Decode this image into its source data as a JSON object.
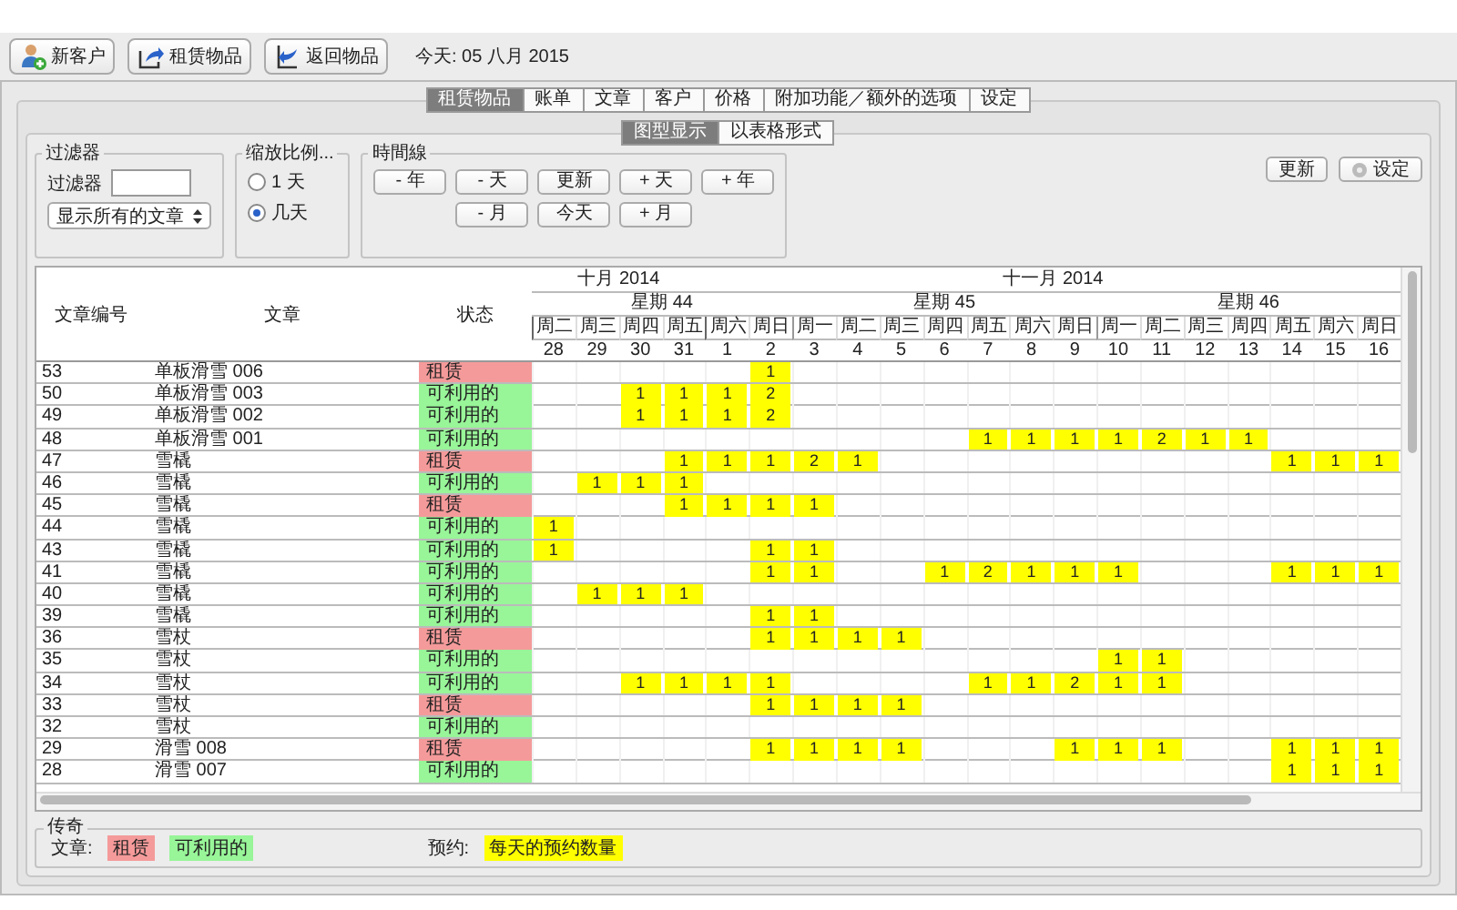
{
  "toolbar": {
    "buttons": [
      {
        "label": "新客户",
        "kind": "person"
      },
      {
        "label": "租赁物品",
        "kind": "out"
      },
      {
        "label": "返回物品",
        "kind": "back"
      }
    ],
    "today": "今天: 05 八月 2015"
  },
  "tabs": [
    {
      "label": "租赁物品",
      "selected": true
    },
    {
      "label": "账单",
      "selected": false
    },
    {
      "label": "文章",
      "selected": false
    },
    {
      "label": "客户",
      "selected": false
    },
    {
      "label": "价格",
      "selected": false
    },
    {
      "label": "附加功能／额外的选项",
      "selected": false
    },
    {
      "label": "设定",
      "selected": false
    }
  ],
  "view_tabs": [
    {
      "label": "图型显示",
      "selected": true
    },
    {
      "label": "以表格形式",
      "selected": false
    }
  ],
  "filter": {
    "title": "过滤器",
    "label": "过滤器",
    "select": "显示所有的文章"
  },
  "scale": {
    "title": "缩放比例...",
    "options": [
      {
        "label": "1 天",
        "selected": false
      },
      {
        "label": "几天",
        "selected": true
      }
    ]
  },
  "timeline": {
    "title": "時間線",
    "rows": [
      [
        "- 年",
        "- 天",
        "更新",
        "+ 天",
        "+ 年"
      ],
      [
        "",
        "- 月",
        "今天",
        "+ 月"
      ]
    ]
  },
  "actions": {
    "refresh": "更新",
    "settings": "设定"
  },
  "table": {
    "columns": [
      "文章编号",
      "文章",
      "状态"
    ],
    "months": [
      "十月 2014",
      "十一月 2014"
    ],
    "weeks": [
      "星期 44",
      "星期 45",
      "星期 46"
    ],
    "days": [
      {
        "weekday": "周二",
        "date": "28",
        "month_start": true,
        "week_start": true
      },
      {
        "weekday": "周三",
        "date": "29",
        "month_start": false,
        "week_start": false
      },
      {
        "weekday": "周四",
        "date": "30",
        "month_start": false,
        "week_start": false
      },
      {
        "weekday": "周五",
        "date": "31",
        "month_start": false,
        "week_start": false
      },
      {
        "weekday": "周六",
        "date": "1",
        "month_start": true,
        "week_start": false
      },
      {
        "weekday": "周日",
        "date": "2",
        "month_start": false,
        "week_start": false
      },
      {
        "weekday": "周一",
        "date": "3",
        "month_start": false,
        "week_start": true
      },
      {
        "weekday": "周二",
        "date": "4",
        "month_start": false,
        "week_start": false
      },
      {
        "weekday": "周三",
        "date": "5",
        "month_start": false,
        "week_start": false
      },
      {
        "weekday": "周四",
        "date": "6",
        "month_start": false,
        "week_start": false
      },
      {
        "weekday": "周五",
        "date": "7",
        "month_start": false,
        "week_start": false
      },
      {
        "weekday": "周六",
        "date": "8",
        "month_start": false,
        "week_start": false
      },
      {
        "weekday": "周日",
        "date": "9",
        "month_start": false,
        "week_start": false
      },
      {
        "weekday": "周一",
        "date": "10",
        "month_start": false,
        "week_start": true
      },
      {
        "weekday": "周二",
        "date": "11",
        "month_start": false,
        "week_start": false
      },
      {
        "weekday": "周三",
        "date": "12",
        "month_start": false,
        "week_start": false
      },
      {
        "weekday": "周四",
        "date": "13",
        "month_start": false,
        "week_start": false
      },
      {
        "weekday": "周五",
        "date": "14",
        "month_start": false,
        "week_start": false
      },
      {
        "weekday": "周六",
        "date": "15",
        "month_start": false,
        "week_start": false
      },
      {
        "weekday": "周日",
        "date": "16",
        "month_start": false,
        "week_start": false
      }
    ],
    "rows": [
      {
        "id": "53",
        "article": "单板滑雪 006",
        "status": {
          "label": "租赁",
          "kind": "rented"
        },
        "bookings": [
          {
            "booked": false
          },
          {
            "booked": false
          },
          {
            "booked": false
          },
          {
            "booked": false
          },
          {
            "booked": false
          },
          {
            "booked": true,
            "count": "1"
          },
          {
            "booked": false
          },
          {
            "booked": false
          },
          {
            "booked": false
          },
          {
            "booked": false
          },
          {
            "booked": false
          },
          {
            "booked": false
          },
          {
            "booked": false
          },
          {
            "booked": false
          },
          {
            "booked": false
          },
          {
            "booked": false
          },
          {
            "booked": false
          },
          {
            "booked": false
          },
          {
            "booked": false
          },
          {
            "booked": false
          }
        ]
      },
      {
        "id": "50",
        "article": "单板滑雪 003",
        "status": {
          "label": "可利用的",
          "kind": "available"
        },
        "bookings": [
          {
            "booked": false
          },
          {
            "booked": false
          },
          {
            "booked": true,
            "count": "1"
          },
          {
            "booked": true,
            "count": "1"
          },
          {
            "booked": true,
            "count": "1"
          },
          {
            "booked": true,
            "count": "2"
          },
          {
            "booked": false
          },
          {
            "booked": false
          },
          {
            "booked": false
          },
          {
            "booked": false
          },
          {
            "booked": false
          },
          {
            "booked": false
          },
          {
            "booked": false
          },
          {
            "booked": false
          },
          {
            "booked": false
          },
          {
            "booked": false
          },
          {
            "booked": false
          },
          {
            "booked": false
          },
          {
            "booked": false
          },
          {
            "booked": false
          }
        ]
      },
      {
        "id": "49",
        "article": "单板滑雪 002",
        "status": {
          "label": "可利用的",
          "kind": "available"
        },
        "bookings": [
          {
            "booked": false
          },
          {
            "booked": false
          },
          {
            "booked": true,
            "count": "1"
          },
          {
            "booked": true,
            "count": "1"
          },
          {
            "booked": true,
            "count": "1"
          },
          {
            "booked": true,
            "count": "2"
          },
          {
            "booked": false
          },
          {
            "booked": false
          },
          {
            "booked": false
          },
          {
            "booked": false
          },
          {
            "booked": false
          },
          {
            "booked": false
          },
          {
            "booked": false
          },
          {
            "booked": false
          },
          {
            "booked": false
          },
          {
            "booked": false
          },
          {
            "booked": false
          },
          {
            "booked": false
          },
          {
            "booked": false
          },
          {
            "booked": false
          }
        ]
      },
      {
        "id": "48",
        "article": "单板滑雪 001",
        "status": {
          "label": "可利用的",
          "kind": "available"
        },
        "bookings": [
          {
            "booked": false
          },
          {
            "booked": false
          },
          {
            "booked": false
          },
          {
            "booked": false
          },
          {
            "booked": false
          },
          {
            "booked": false
          },
          {
            "booked": false
          },
          {
            "booked": false
          },
          {
            "booked": false
          },
          {
            "booked": false
          },
          {
            "booked": true,
            "count": "1"
          },
          {
            "booked": true,
            "count": "1"
          },
          {
            "booked": true,
            "count": "1"
          },
          {
            "booked": true,
            "count": "1"
          },
          {
            "booked": true,
            "count": "2"
          },
          {
            "booked": true,
            "count": "1"
          },
          {
            "booked": true,
            "count": "1"
          },
          {
            "booked": false
          },
          {
            "booked": false
          },
          {
            "booked": false
          }
        ]
      },
      {
        "id": "47",
        "article": "雪橇",
        "status": {
          "label": "租赁",
          "kind": "rented"
        },
        "bookings": [
          {
            "booked": false
          },
          {
            "booked": false
          },
          {
            "booked": false
          },
          {
            "booked": true,
            "count": "1"
          },
          {
            "booked": true,
            "count": "1"
          },
          {
            "booked": true,
            "count": "1"
          },
          {
            "booked": true,
            "count": "2"
          },
          {
            "booked": true,
            "count": "1"
          },
          {
            "booked": false
          },
          {
            "booked": false
          },
          {
            "booked": false
          },
          {
            "booked": false
          },
          {
            "booked": false
          },
          {
            "booked": false
          },
          {
            "booked": false
          },
          {
            "booked": false
          },
          {
            "booked": false
          },
          {
            "booked": true,
            "count": "1"
          },
          {
            "booked": true,
            "count": "1"
          },
          {
            "booked": true,
            "count": "1"
          }
        ]
      },
      {
        "id": "46",
        "article": "雪橇",
        "status": {
          "label": "可利用的",
          "kind": "available"
        },
        "bookings": [
          {
            "booked": false
          },
          {
            "booked": true,
            "count": "1"
          },
          {
            "booked": true,
            "count": "1"
          },
          {
            "booked": true,
            "count": "1"
          },
          {
            "booked": false
          },
          {
            "booked": false
          },
          {
            "booked": false
          },
          {
            "booked": false
          },
          {
            "booked": false
          },
          {
            "booked": false
          },
          {
            "booked": false
          },
          {
            "booked": false
          },
          {
            "booked": false
          },
          {
            "booked": false
          },
          {
            "booked": false
          },
          {
            "booked": false
          },
          {
            "booked": false
          },
          {
            "booked": false
          },
          {
            "booked": false
          },
          {
            "booked": false
          }
        ]
      },
      {
        "id": "45",
        "article": "雪橇",
        "status": {
          "label": "租赁",
          "kind": "rented"
        },
        "bookings": [
          {
            "booked": false
          },
          {
            "booked": false
          },
          {
            "booked": false
          },
          {
            "booked": true,
            "count": "1"
          },
          {
            "booked": true,
            "count": "1"
          },
          {
            "booked": true,
            "count": "1"
          },
          {
            "booked": true,
            "count": "1"
          },
          {
            "booked": false
          },
          {
            "booked": false
          },
          {
            "booked": false
          },
          {
            "booked": false
          },
          {
            "booked": false
          },
          {
            "booked": false
          },
          {
            "booked": false
          },
          {
            "booked": false
          },
          {
            "booked": false
          },
          {
            "booked": false
          },
          {
            "booked": false
          },
          {
            "booked": false
          },
          {
            "booked": false
          }
        ]
      },
      {
        "id": "44",
        "article": "雪橇",
        "status": {
          "label": "可利用的",
          "kind": "available"
        },
        "bookings": [
          {
            "booked": true,
            "count": "1"
          },
          {
            "booked": false
          },
          {
            "booked": false
          },
          {
            "booked": false
          },
          {
            "booked": false
          },
          {
            "booked": false
          },
          {
            "booked": false
          },
          {
            "booked": false
          },
          {
            "booked": false
          },
          {
            "booked": false
          },
          {
            "booked": false
          },
          {
            "booked": false
          },
          {
            "booked": false
          },
          {
            "booked": false
          },
          {
            "booked": false
          },
          {
            "booked": false
          },
          {
            "booked": false
          },
          {
            "booked": false
          },
          {
            "booked": false
          },
          {
            "booked": false
          }
        ]
      },
      {
        "id": "43",
        "article": "雪橇",
        "status": {
          "label": "可利用的",
          "kind": "available"
        },
        "bookings": [
          {
            "booked": true,
            "count": "1"
          },
          {
            "booked": false
          },
          {
            "booked": false
          },
          {
            "booked": false
          },
          {
            "booked": false
          },
          {
            "booked": true,
            "count": "1"
          },
          {
            "booked": true,
            "count": "1"
          },
          {
            "booked": false
          },
          {
            "booked": false
          },
          {
            "booked": false
          },
          {
            "booked": false
          },
          {
            "booked": false
          },
          {
            "booked": false
          },
          {
            "booked": false
          },
          {
            "booked": false
          },
          {
            "booked": false
          },
          {
            "booked": false
          },
          {
            "booked": false
          },
          {
            "booked": false
          },
          {
            "booked": false
          }
        ]
      },
      {
        "id": "41",
        "article": "雪橇",
        "status": {
          "label": "可利用的",
          "kind": "available"
        },
        "bookings": [
          {
            "booked": false
          },
          {
            "booked": false
          },
          {
            "booked": false
          },
          {
            "booked": false
          },
          {
            "booked": false
          },
          {
            "booked": true,
            "count": "1"
          },
          {
            "booked": true,
            "count": "1"
          },
          {
            "booked": false
          },
          {
            "booked": false
          },
          {
            "booked": true,
            "count": "1"
          },
          {
            "booked": true,
            "count": "2"
          },
          {
            "booked": true,
            "count": "1"
          },
          {
            "booked": true,
            "count": "1"
          },
          {
            "booked": true,
            "count": "1"
          },
          {
            "booked": false
          },
          {
            "booked": false
          },
          {
            "booked": false
          },
          {
            "booked": true,
            "count": "1"
          },
          {
            "booked": true,
            "count": "1"
          },
          {
            "booked": true,
            "count": "1"
          }
        ]
      },
      {
        "id": "40",
        "article": "雪橇",
        "status": {
          "label": "可利用的",
          "kind": "available"
        },
        "bookings": [
          {
            "booked": false
          },
          {
            "booked": true,
            "count": "1"
          },
          {
            "booked": true,
            "count": "1"
          },
          {
            "booked": true,
            "count": "1"
          },
          {
            "booked": false
          },
          {
            "booked": false
          },
          {
            "booked": false
          },
          {
            "booked": false
          },
          {
            "booked": false
          },
          {
            "booked": false
          },
          {
            "booked": false
          },
          {
            "booked": false
          },
          {
            "booked": false
          },
          {
            "booked": false
          },
          {
            "booked": false
          },
          {
            "booked": false
          },
          {
            "booked": false
          },
          {
            "booked": false
          },
          {
            "booked": false
          },
          {
            "booked": false
          }
        ]
      },
      {
        "id": "39",
        "article": "雪橇",
        "status": {
          "label": "可利用的",
          "kind": "available"
        },
        "bookings": [
          {
            "booked": false
          },
          {
            "booked": false
          },
          {
            "booked": false
          },
          {
            "booked": false
          },
          {
            "booked": false
          },
          {
            "booked": true,
            "count": "1"
          },
          {
            "booked": true,
            "count": "1"
          },
          {
            "booked": false
          },
          {
            "booked": false
          },
          {
            "booked": false
          },
          {
            "booked": false
          },
          {
            "booked": false
          },
          {
            "booked": false
          },
          {
            "booked": false
          },
          {
            "booked": false
          },
          {
            "booked": false
          },
          {
            "booked": false
          },
          {
            "booked": false
          },
          {
            "booked": false
          },
          {
            "booked": false
          }
        ]
      },
      {
        "id": "36",
        "article": "雪杖",
        "status": {
          "label": "租赁",
          "kind": "rented"
        },
        "bookings": [
          {
            "booked": false
          },
          {
            "booked": false
          },
          {
            "booked": false
          },
          {
            "booked": false
          },
          {
            "booked": false
          },
          {
            "booked": true,
            "count": "1"
          },
          {
            "booked": true,
            "count": "1"
          },
          {
            "booked": true,
            "count": "1"
          },
          {
            "booked": true,
            "count": "1"
          },
          {
            "booked": false
          },
          {
            "booked": false
          },
          {
            "booked": false
          },
          {
            "booked": false
          },
          {
            "booked": false
          },
          {
            "booked": false
          },
          {
            "booked": false
          },
          {
            "booked": false
          },
          {
            "booked": false
          },
          {
            "booked": false
          },
          {
            "booked": false
          }
        ]
      },
      {
        "id": "35",
        "article": "雪杖",
        "status": {
          "label": "可利用的",
          "kind": "available"
        },
        "bookings": [
          {
            "booked": false
          },
          {
            "booked": false
          },
          {
            "booked": false
          },
          {
            "booked": false
          },
          {
            "booked": false
          },
          {
            "booked": false
          },
          {
            "booked": false
          },
          {
            "booked": false
          },
          {
            "booked": false
          },
          {
            "booked": false
          },
          {
            "booked": false
          },
          {
            "booked": false
          },
          {
            "booked": false
          },
          {
            "booked": true,
            "count": "1"
          },
          {
            "booked": true,
            "count": "1"
          },
          {
            "booked": false
          },
          {
            "booked": false
          },
          {
            "booked": false
          },
          {
            "booked": false
          },
          {
            "booked": false
          }
        ]
      },
      {
        "id": "34",
        "article": "雪杖",
        "status": {
          "label": "可利用的",
          "kind": "available"
        },
        "bookings": [
          {
            "booked": false
          },
          {
            "booked": false
          },
          {
            "booked": true,
            "count": "1"
          },
          {
            "booked": true,
            "count": "1"
          },
          {
            "booked": true,
            "count": "1"
          },
          {
            "booked": true,
            "count": "1"
          },
          {
            "booked": false
          },
          {
            "booked": false
          },
          {
            "booked": false
          },
          {
            "booked": false
          },
          {
            "booked": true,
            "count": "1"
          },
          {
            "booked": true,
            "count": "1"
          },
          {
            "booked": true,
            "count": "2"
          },
          {
            "booked": true,
            "count": "1"
          },
          {
            "booked": true,
            "count": "1"
          },
          {
            "booked": false
          },
          {
            "booked": false
          },
          {
            "booked": false
          },
          {
            "booked": false
          },
          {
            "booked": false
          }
        ]
      },
      {
        "id": "33",
        "article": "雪杖",
        "status": {
          "label": "租赁",
          "kind": "rented"
        },
        "bookings": [
          {
            "booked": false
          },
          {
            "booked": false
          },
          {
            "booked": false
          },
          {
            "booked": false
          },
          {
            "booked": false
          },
          {
            "booked": true,
            "count": "1"
          },
          {
            "booked": true,
            "count": "1"
          },
          {
            "booked": true,
            "count": "1"
          },
          {
            "booked": true,
            "count": "1"
          },
          {
            "booked": false
          },
          {
            "booked": false
          },
          {
            "booked": false
          },
          {
            "booked": false
          },
          {
            "booked": false
          },
          {
            "booked": false
          },
          {
            "booked": false
          },
          {
            "booked": false
          },
          {
            "booked": false
          },
          {
            "booked": false
          },
          {
            "booked": false
          }
        ]
      },
      {
        "id": "32",
        "article": "雪杖",
        "status": {
          "label": "可利用的",
          "kind": "available"
        },
        "bookings": [
          {
            "booked": false
          },
          {
            "booked": false
          },
          {
            "booked": false
          },
          {
            "booked": false
          },
          {
            "booked": false
          },
          {
            "booked": false
          },
          {
            "booked": false
          },
          {
            "booked": false
          },
          {
            "booked": false
          },
          {
            "booked": false
          },
          {
            "booked": false
          },
          {
            "booked": false
          },
          {
            "booked": false
          },
          {
            "booked": false
          },
          {
            "booked": false
          },
          {
            "booked": false
          },
          {
            "booked": false
          },
          {
            "booked": false
          },
          {
            "booked": false
          },
          {
            "booked": false
          }
        ]
      },
      {
        "id": "29",
        "article": "滑雪 008",
        "status": {
          "label": "租赁",
          "kind": "rented"
        },
        "bookings": [
          {
            "booked": false
          },
          {
            "booked": false
          },
          {
            "booked": false
          },
          {
            "booked": false
          },
          {
            "booked": false
          },
          {
            "booked": true,
            "count": "1"
          },
          {
            "booked": true,
            "count": "1"
          },
          {
            "booked": true,
            "count": "1"
          },
          {
            "booked": true,
            "count": "1"
          },
          {
            "booked": false
          },
          {
            "booked": false
          },
          {
            "booked": false
          },
          {
            "booked": true,
            "count": "1"
          },
          {
            "booked": true,
            "count": "1"
          },
          {
            "booked": true,
            "count": "1"
          },
          {
            "booked": false
          },
          {
            "booked": false
          },
          {
            "booked": true,
            "count": "1"
          },
          {
            "booked": true,
            "count": "1"
          },
          {
            "booked": true,
            "count": "1"
          }
        ]
      },
      {
        "id": "28",
        "article": "滑雪 007",
        "status": {
          "label": "可利用的",
          "kind": "available"
        },
        "bookings": [
          {
            "booked": false
          },
          {
            "booked": false
          },
          {
            "booked": false
          },
          {
            "booked": false
          },
          {
            "booked": false
          },
          {
            "booked": false
          },
          {
            "booked": false
          },
          {
            "booked": false
          },
          {
            "booked": false
          },
          {
            "booked": false
          },
          {
            "booked": false
          },
          {
            "booked": false
          },
          {
            "booked": false
          },
          {
            "booked": false
          },
          {
            "booked": false
          },
          {
            "booked": false
          },
          {
            "booked": false
          },
          {
            "booked": true,
            "count": "1"
          },
          {
            "booked": true,
            "count": "1"
          },
          {
            "booked": true,
            "count": "1"
          }
        ]
      }
    ]
  },
  "legend": {
    "title": "传奇",
    "article_label": "文章:",
    "items": [
      {
        "label": "租赁",
        "kind": "rented"
      },
      {
        "label": "可利用的",
        "kind": "available"
      }
    ],
    "booking_label": "预约:",
    "booking_item": "每天的预约数量"
  }
}
